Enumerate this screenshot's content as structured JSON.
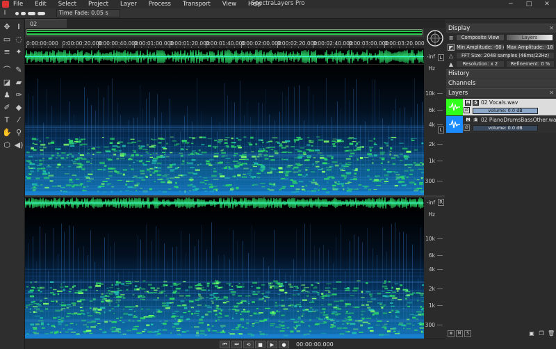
{
  "app": {
    "title": "SpectraLayers Pro"
  },
  "menu": [
    "File",
    "Edit",
    "Select",
    "Project",
    "Layer",
    "Process",
    "Transport",
    "View",
    "Help"
  ],
  "window_controls": {
    "minimize": "─",
    "maximize": "□",
    "close": "✕"
  },
  "options": {
    "tool_glyph": "I",
    "time_fade": "Time Fade: 0.05 s"
  },
  "tabs": [
    {
      "label": "02 Vocals.wav*"
    }
  ],
  "ruler": {
    "labels": [
      "0:00:00:000",
      "0:00:00:20.000",
      "0:00:00:40.000",
      "0:00:01:00.000",
      "0:00:01:20.000",
      "0:00:01:40.000",
      "0:00:02:00.000",
      "0:00:02:20.000",
      "0:00:02:40.000",
      "0:00:03:00.000",
      "0:00:03:20.000"
    ]
  },
  "channel_scale": {
    "inf": "-inf",
    "hz": "Hz",
    "ticks": [
      "10k",
      "6k",
      "4k",
      "2k",
      "1k",
      "300"
    ],
    "left": "L",
    "right": "R"
  },
  "transport": {
    "timecode": "00:00:00.000",
    "buttons": [
      "⏮",
      "⏭",
      "⟲",
      "■",
      "▶",
      "●"
    ]
  },
  "panel": {
    "display": {
      "title": "Display",
      "composite_view": "Composite View",
      "layers_label": "Layers",
      "min_amp": "Min Amplitude: -90 dB",
      "max_amp": "Max Amplitude: -18 dB",
      "fft": "FFT Size: 2048 samples (46ms/22Hz)",
      "resolution": "Resolution: x 2",
      "refinement": "Refinement: 0 %"
    },
    "history": {
      "title": "History"
    },
    "channels": {
      "title": "Channels"
    },
    "layers": {
      "title": "Layers",
      "items": [
        {
          "name": "02 Vocals.wav",
          "volume": "volume: 0.0 dB",
          "color": "#2fff1a",
          "selected": true
        },
        {
          "name": "02 PianoDrumsBassOther.wav",
          "volume": "volume: 0.0 dB",
          "color": "#1a8cff",
          "selected": false
        }
      ]
    },
    "footer": {
      "m": "M",
      "s": "S"
    }
  }
}
